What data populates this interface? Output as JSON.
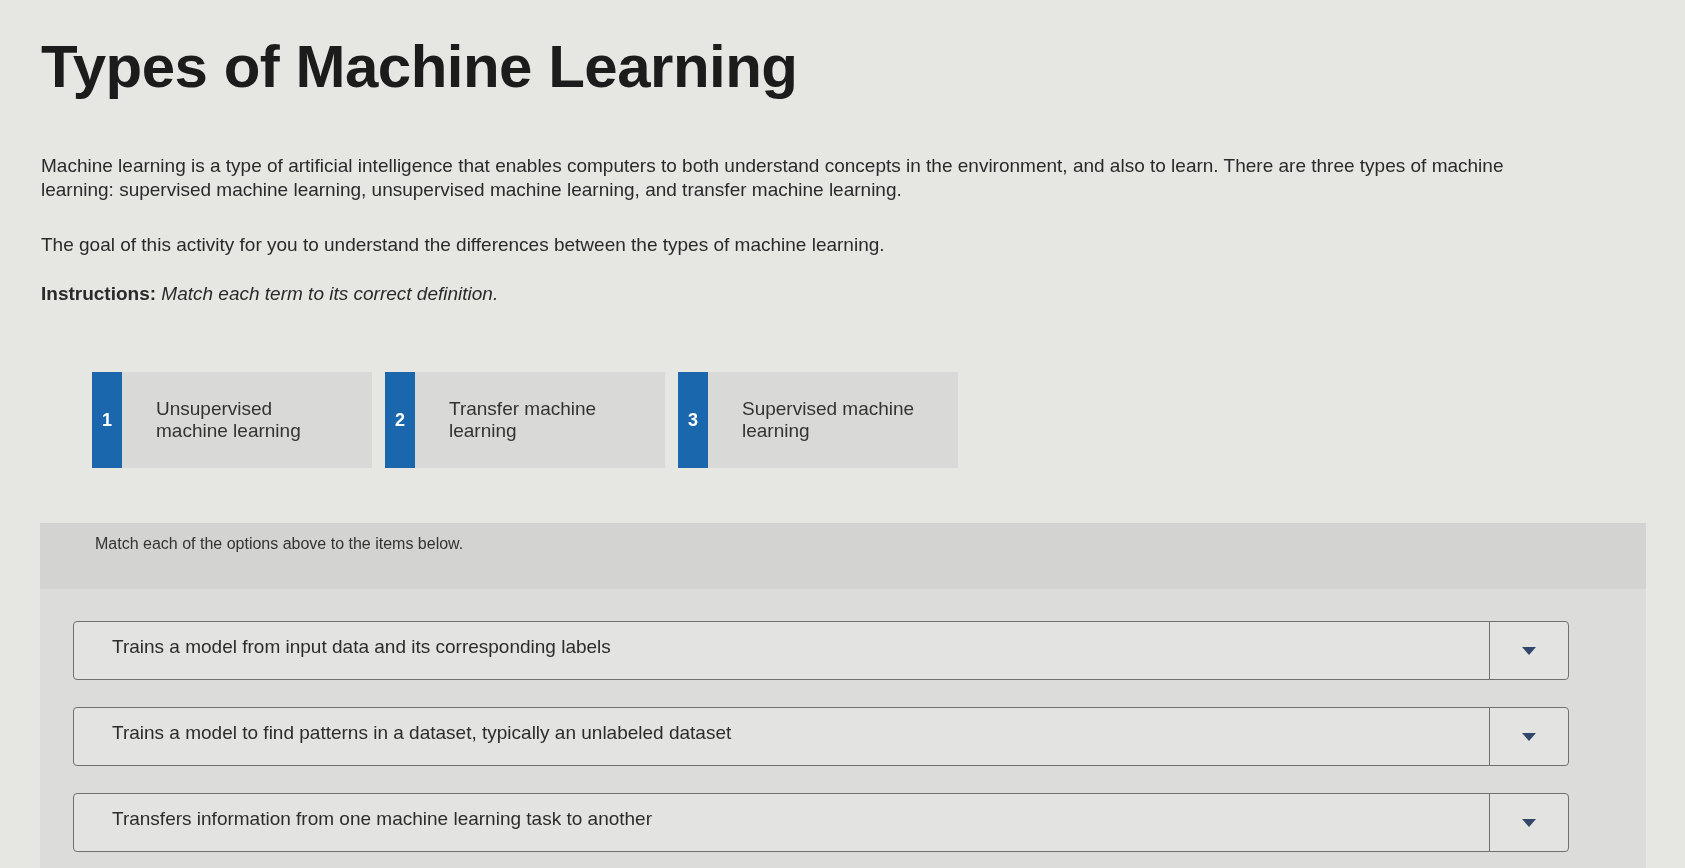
{
  "title": "Types of Machine Learning",
  "intro": "Machine learning is a type of artificial intelligence that enables computers to both understand concepts in the environment, and also to learn. There are three types of machine learning: supervised machine learning, unsupervised machine learning, and transfer machine learning.",
  "goal": "The goal of this activity for you to understand the differences between the types of machine learning.",
  "instructions": "**Instructions:** *Match each term to its correct definition.*",
  "terms": [
    {
      "number": "1",
      "label": "Unsupervised machine learning"
    },
    {
      "number": "2",
      "label": "Transfer machine learning"
    },
    {
      "number": "3",
      "label": "Supervised machine learning"
    }
  ],
  "matching": {
    "prompt": "Match each of the options above to the items below.",
    "items": [
      {
        "text": "Trains a model from input data and its corresponding labels"
      },
      {
        "text": "Trains a model to find patterns in a dataset, typically an unlabeled dataset"
      },
      {
        "text": "Transfers information from one machine learning task to another"
      }
    ]
  }
}
